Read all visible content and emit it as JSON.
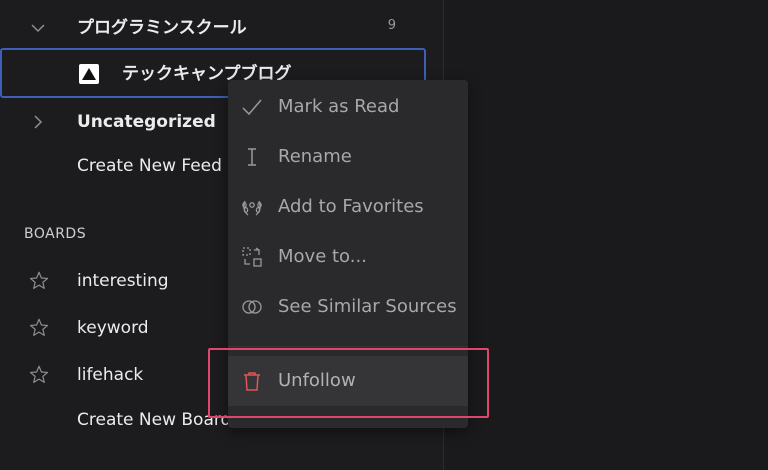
{
  "sidebar": {
    "feeds": [
      {
        "label": "プログラミンスクール",
        "count": "9",
        "expanded": true
      },
      {
        "label": "Uncategorized",
        "expanded": false
      }
    ],
    "selected_feed": {
      "label": "テックキャンプブログ",
      "favicon": "triangle-logo-icon"
    },
    "create_feed": "Create New Feed",
    "boards_title": "BOARDS",
    "boards": [
      {
        "label": "interesting"
      },
      {
        "label": "keyword"
      },
      {
        "label": "lifehack"
      }
    ],
    "create_board": "Create New Board"
  },
  "context_menu": {
    "items": [
      {
        "label": "Mark as Read",
        "icon": "checkmark-icon"
      },
      {
        "label": "Rename",
        "icon": "text-cursor-icon"
      },
      {
        "label": "Add to Favorites",
        "icon": "laurel-icon"
      },
      {
        "label": "Move to...",
        "icon": "move-icon"
      },
      {
        "label": "See Similar Sources",
        "icon": "overlap-circles-icon"
      },
      {
        "label": "Unfollow",
        "icon": "trash-icon"
      }
    ]
  },
  "colors": {
    "background": "#1c1c1e",
    "menu_bg": "#2a2a2d",
    "selection_border": "#3d5fb8",
    "highlight_border": "#e0456e",
    "danger": "#e05555"
  }
}
